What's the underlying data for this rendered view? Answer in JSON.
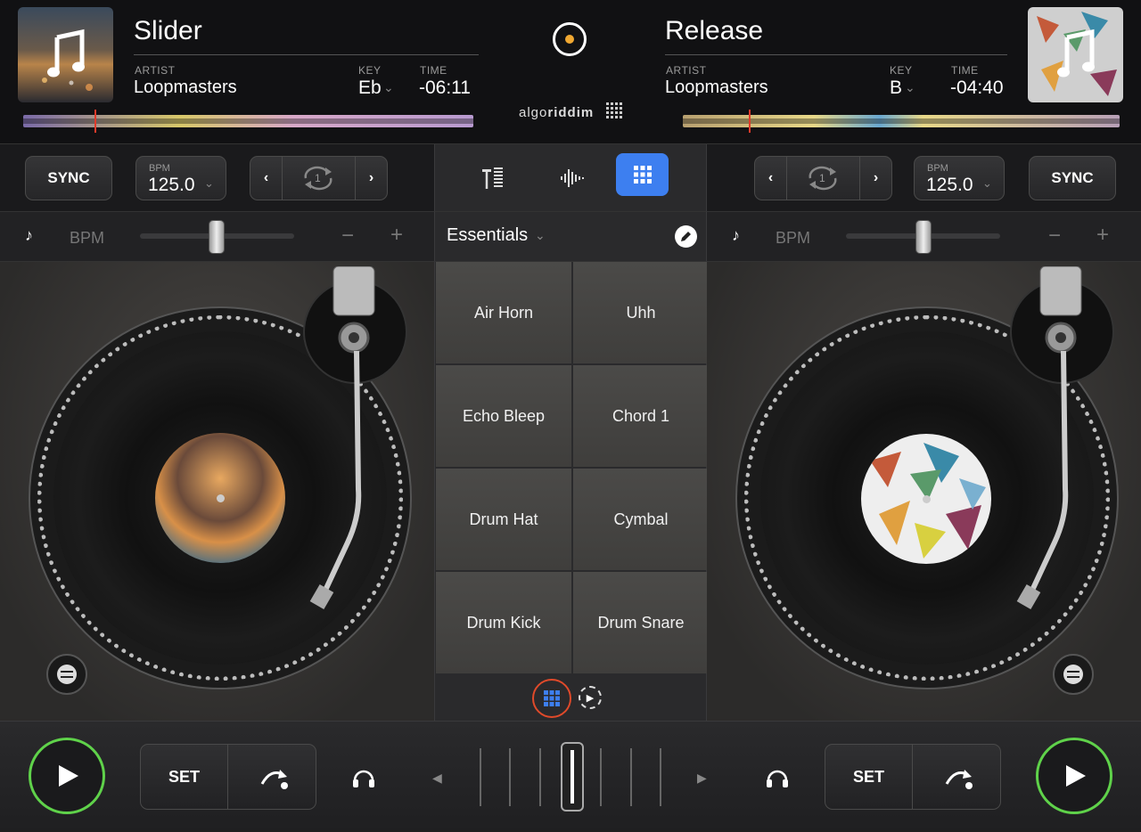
{
  "deck_left": {
    "title": "Slider",
    "artist_label": "ARTIST",
    "artist": "Loopmasters",
    "key_label": "KEY",
    "key": "Eb",
    "time_label": "TIME",
    "time": "-06:11",
    "sync_label": "SYNC",
    "bpm_label": "BPM",
    "bpm": "125.0",
    "loop_count": "1",
    "pitch_label": "BPM",
    "set_label": "SET"
  },
  "deck_right": {
    "title": "Release",
    "artist_label": "ARTIST",
    "artist": "Loopmasters",
    "key_label": "KEY",
    "key": "B",
    "time_label": "TIME",
    "time": "-04:40",
    "sync_label": "SYNC",
    "bpm_label": "BPM",
    "bpm": "125.0",
    "loop_count": "1",
    "pitch_label": "BPM",
    "set_label": "SET"
  },
  "brand": {
    "prefix": "algo",
    "suffix": "riddim"
  },
  "sampler": {
    "bank": "Essentials",
    "pads": [
      "Air Horn",
      "Uhh",
      "Echo Bleep",
      "Chord 1",
      "Drum Hat",
      "Cymbal",
      "Drum Kick",
      "Drum Snare"
    ]
  },
  "pitch_minus": "−",
  "pitch_plus": "+",
  "colors": {
    "accent": "#3d7ff0",
    "play_ring": "#5fd24a",
    "playhead": "#e03a2a"
  }
}
